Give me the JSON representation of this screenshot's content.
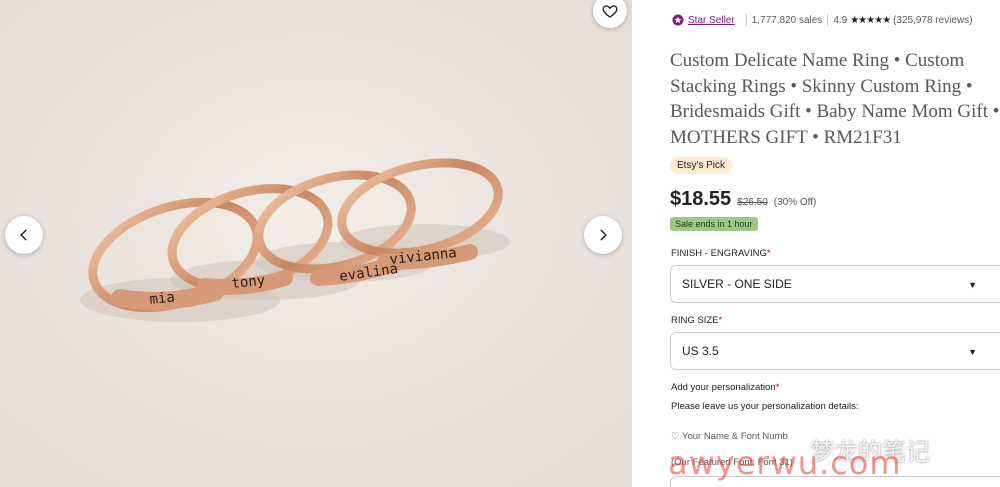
{
  "gallery": {
    "ring_names": [
      "mia",
      "tony",
      "evalina",
      "vivianna"
    ]
  },
  "seller": {
    "badge": "Star Seller",
    "sales": "1,777,820 sales",
    "rating": "4.9",
    "stars": "★★★★★",
    "reviews": "(325,978 reviews)"
  },
  "listing": {
    "title": "Custom Delicate Name Ring • Custom Stacking Rings • Skinny Custom Ring • Bridesmaids Gift • Baby Name Mom Gift • MOTHERS GIFT • RM21F31",
    "etsy_pick": "Etsy's Pick",
    "price": "$18.55",
    "original_price": "$26.50",
    "discount": "(30% Off)",
    "sale_badge": "Sale ends in 1 hour"
  },
  "options": {
    "finish_label": "FINISH - ENGRAVING",
    "finish_value": "SILVER - ONE SIDE",
    "size_label": "RING SIZE",
    "size_value": "US 3.5",
    "required_mark": "*"
  },
  "personalization": {
    "label": "Add your personalization",
    "hint": "Please leave us your personalization details:",
    "line1": "♡ Your Name & Font Numb",
    "line2": "(Our Featured Font: Font 31)"
  },
  "watermark": {
    "text": "梦龙的笔记",
    "url": "awyerwu.com"
  },
  "colors": {
    "star_seller": "#7f187f",
    "sale_badge": "#9ec88a",
    "pick_badge": "#fdebd2"
  }
}
